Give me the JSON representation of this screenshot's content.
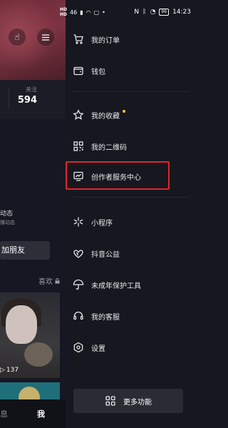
{
  "status_bar": {
    "left_signal_a": "HD",
    "left_signal_b": "HD",
    "left_net": "46",
    "right_time": "14:23",
    "battery": "96"
  },
  "profile_bg": {
    "following_label": "关注",
    "following_count": "594",
    "dynamic_title": "动态",
    "dynamic_sub": "播动态",
    "add_friend": "加朋友",
    "likes_tab": "喜欢",
    "view_count": "137",
    "nav_messages": "息",
    "nav_me": "我"
  },
  "drawer": {
    "items": [
      {
        "label": "我的订单",
        "icon": "cart-icon"
      },
      {
        "label": "钱包",
        "icon": "wallet-icon"
      },
      {
        "label": "我的收藏",
        "icon": "star-icon"
      },
      {
        "label": "我的二维码",
        "icon": "qrcode-icon"
      },
      {
        "label": "创作者服务中心",
        "icon": "creator-center-icon"
      },
      {
        "label": "小程序",
        "icon": "mini-program-icon"
      },
      {
        "label": "抖音公益",
        "icon": "charity-icon"
      },
      {
        "label": "未成年保护工具",
        "icon": "umbrella-icon"
      },
      {
        "label": "我的客服",
        "icon": "headset-icon"
      },
      {
        "label": "设置",
        "icon": "settings-icon"
      }
    ],
    "more_button": "更多功能"
  },
  "colors": {
    "background": "#16171f",
    "highlight_border": "#e0262b",
    "notification_dot": "#f6c343"
  }
}
